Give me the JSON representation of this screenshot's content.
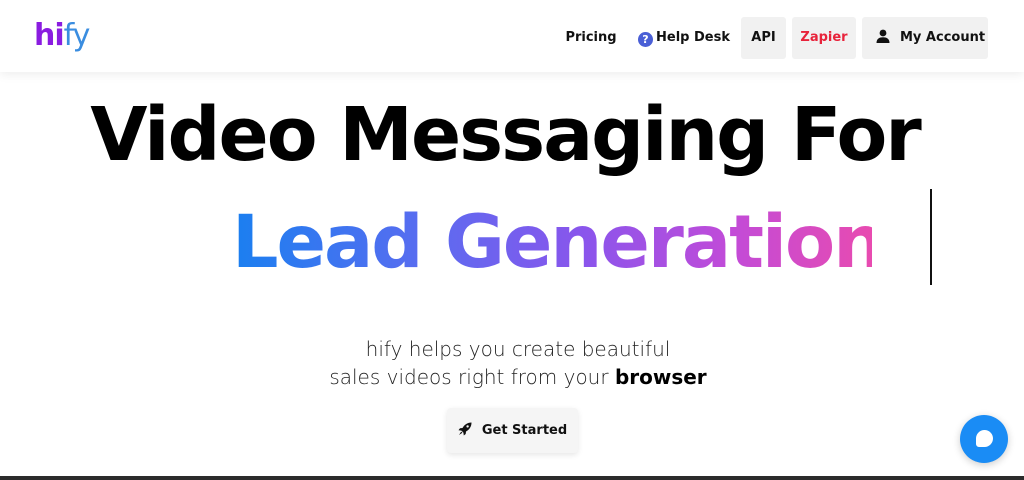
{
  "header": {
    "logo_part1": "hi",
    "logo_part2": "fy",
    "nav": {
      "pricing": "Pricing",
      "help_desk": "Help Desk",
      "api": "API",
      "zapier": "Zapier",
      "my_account": "My Account"
    }
  },
  "hero": {
    "headline_line1": "Video Messaging For",
    "headline_line2": "Lead Generation",
    "subtitle_line1": "hify helps you create beautiful",
    "subtitle_line2_prefix": "sales videos right from your ",
    "subtitle_line2_bold": "browser",
    "cta_label": "Get Started"
  },
  "icons": {
    "help": "question-circle-icon",
    "account": "user-icon",
    "cta": "rocket-icon",
    "chat": "chat-bubble-icon"
  },
  "colors": {
    "logo_hi": "#8a1ce0",
    "logo_fy": "#3a8de0",
    "zapier": "#e8233b",
    "gradient_start": "#1a7ff0",
    "gradient_end": "#e84bb0",
    "chat_button": "#1a8cf5"
  }
}
